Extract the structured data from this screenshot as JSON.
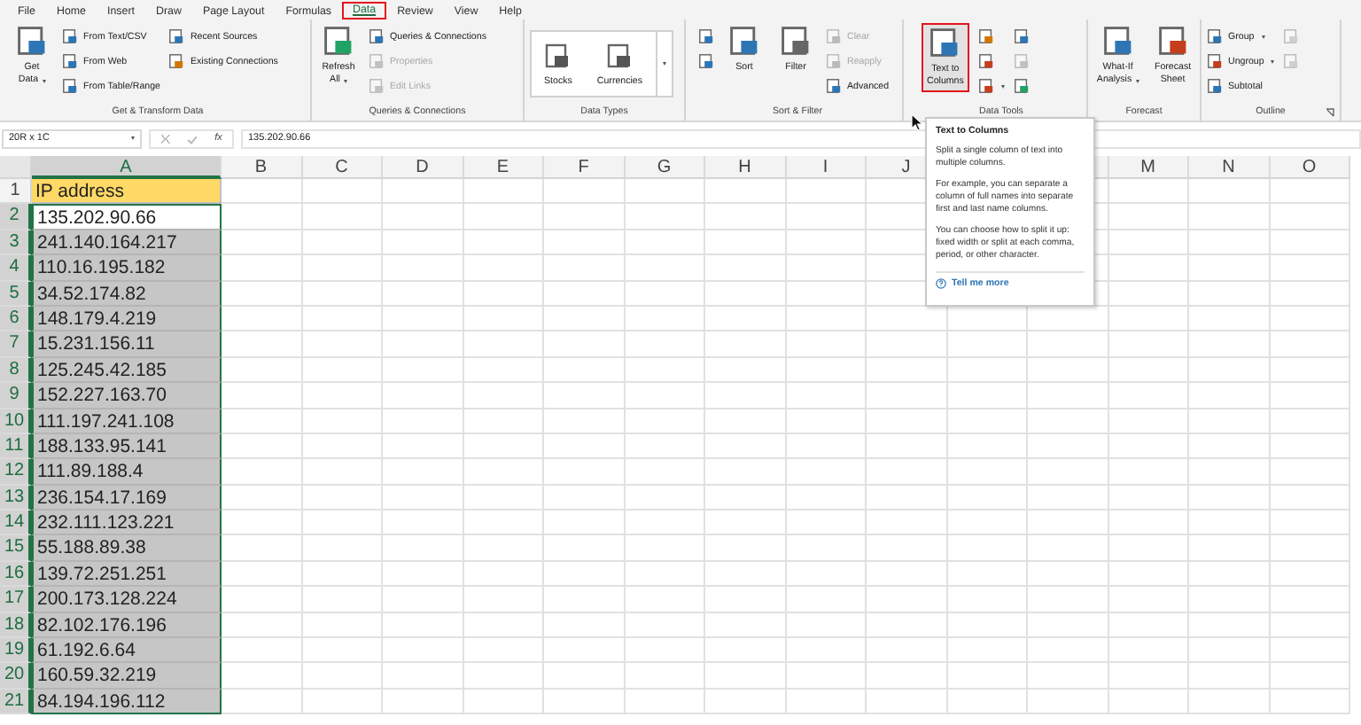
{
  "menu_tabs": [
    {
      "label": "File",
      "selected": false,
      "highlighted": false
    },
    {
      "label": "Home",
      "selected": false,
      "highlighted": false
    },
    {
      "label": "Insert",
      "selected": false,
      "highlighted": false
    },
    {
      "label": "Draw",
      "selected": false,
      "highlighted": false
    },
    {
      "label": "Page Layout",
      "selected": false,
      "highlighted": false
    },
    {
      "label": "Formulas",
      "selected": false,
      "highlighted": false
    },
    {
      "label": "Data",
      "selected": true,
      "highlighted": true
    },
    {
      "label": "Review",
      "selected": false,
      "highlighted": false
    },
    {
      "label": "View",
      "selected": false,
      "highlighted": false
    },
    {
      "label": "Help",
      "selected": false,
      "highlighted": false
    }
  ],
  "ribbon": {
    "groups": [
      {
        "label": "Get & Transform Data",
        "launcher": false,
        "parts": [
          {
            "kind": "large",
            "lines": [
              "Get",
              "Data"
            ],
            "dropdown": true
          },
          {
            "kind": "stack",
            "items": [
              {
                "label": "From Text/CSV",
                "disabled": false
              },
              {
                "label": "From Web",
                "disabled": false
              },
              {
                "label": "From Table/Range",
                "disabled": false
              }
            ]
          },
          {
            "kind": "stack",
            "items": [
              {
                "label": "Recent Sources",
                "disabled": false
              },
              {
                "label": "Existing Connections",
                "disabled": false
              }
            ]
          }
        ]
      },
      {
        "label": "Queries & Connections",
        "launcher": false,
        "parts": [
          {
            "kind": "large",
            "lines": [
              "Refresh",
              "All"
            ],
            "dropdown": true
          },
          {
            "kind": "stack",
            "items": [
              {
                "label": "Queries & Connections",
                "disabled": false
              },
              {
                "label": "Properties",
                "disabled": true
              },
              {
                "label": "Edit Links",
                "disabled": true
              }
            ]
          }
        ]
      },
      {
        "label": "Data Types",
        "launcher": false,
        "parts": [
          {
            "kind": "gallery",
            "items": [
              {
                "label": "Stocks"
              },
              {
                "label": "Currencies"
              }
            ]
          }
        ]
      },
      {
        "label": "Sort & Filter",
        "launcher": false,
        "parts": [
          {
            "kind": "stack",
            "items": [
              {
                "disabled": false
              },
              {
                "disabled": false
              }
            ]
          },
          {
            "kind": "large",
            "lines": [
              "Sort"
            ],
            "dropdown": false
          },
          {
            "kind": "large",
            "lines": [
              "Filter"
            ],
            "dropdown": false
          },
          {
            "kind": "stack",
            "items": [
              {
                "label": "Clear",
                "disabled": true
              },
              {
                "label": "Reapply",
                "disabled": true
              },
              {
                "label": "Advanced",
                "disabled": false
              }
            ]
          }
        ]
      },
      {
        "label": "Data Tools",
        "launcher": false,
        "parts": [
          {
            "kind": "large",
            "lines": [
              "Text to",
              "Columns"
            ],
            "dropdown": false,
            "highlighted": true
          },
          {
            "kind": "stack",
            "items": [
              {
                "disabled": false
              },
              {
                "disabled": false
              },
              {
                "disabled": false,
                "dropdown": true
              }
            ]
          },
          {
            "kind": "stack",
            "items": [
              {
                "disabled": false
              },
              {
                "disabled": true
              },
              {
                "disabled": false
              }
            ]
          }
        ]
      },
      {
        "label": "Forecast",
        "launcher": false,
        "parts": [
          {
            "kind": "large",
            "lines": [
              "What-If",
              "Analysis"
            ],
            "dropdown": true
          },
          {
            "kind": "large",
            "lines": [
              "Forecast",
              "Sheet"
            ],
            "dropdown": false
          }
        ]
      },
      {
        "label": "Outline",
        "launcher": true,
        "parts": [
          {
            "kind": "stack",
            "items": [
              {
                "label": "Group",
                "disabled": false,
                "dropdown": true
              },
              {
                "label": "Ungroup",
                "disabled": false,
                "dropdown": true
              },
              {
                "label": "Subtotal",
                "disabled": false
              }
            ]
          },
          {
            "kind": "stack",
            "items": [
              {
                "disabled": true
              },
              {
                "disabled": true
              }
            ]
          }
        ]
      }
    ]
  },
  "formula_bar": {
    "name_box": "20R x 1C",
    "function_label": "fx",
    "value": "135.202.90.66"
  },
  "sheet": {
    "columns": [
      "A",
      "B",
      "C",
      "D",
      "E",
      "F",
      "G",
      "H",
      "I",
      "J",
      null,
      null,
      "M",
      "N",
      "O"
    ],
    "rows": [
      {
        "number": "1",
        "value": "IP address",
        "kind": "header",
        "selected": false,
        "active": false
      },
      {
        "number": "2",
        "value": "135.202.90.66",
        "kind": "data",
        "selected": true,
        "active": true
      },
      {
        "number": "3",
        "value": "241.140.164.217",
        "kind": "data",
        "selected": true,
        "active": false
      },
      {
        "number": "4",
        "value": "110.16.195.182",
        "kind": "data",
        "selected": true,
        "active": false
      },
      {
        "number": "5",
        "value": "34.52.174.82",
        "kind": "data",
        "selected": true,
        "active": false
      },
      {
        "number": "6",
        "value": "148.179.4.219",
        "kind": "data",
        "selected": true,
        "active": false
      },
      {
        "number": "7",
        "value": "15.231.156.11",
        "kind": "data",
        "selected": true,
        "active": false
      },
      {
        "number": "8",
        "value": "125.245.42.185",
        "kind": "data",
        "selected": true,
        "active": false
      },
      {
        "number": "9",
        "value": "152.227.163.70",
        "kind": "data",
        "selected": true,
        "active": false
      },
      {
        "number": "10",
        "value": "111.197.241.108",
        "kind": "data",
        "selected": true,
        "active": false
      },
      {
        "number": "11",
        "value": "188.133.95.141",
        "kind": "data",
        "selected": true,
        "active": false
      },
      {
        "number": "12",
        "value": "111.89.188.4",
        "kind": "data",
        "selected": true,
        "active": false
      },
      {
        "number": "13",
        "value": "236.154.17.169",
        "kind": "data",
        "selected": true,
        "active": false
      },
      {
        "number": "14",
        "value": "232.111.123.221",
        "kind": "data",
        "selected": true,
        "active": false
      },
      {
        "number": "15",
        "value": "55.188.89.38",
        "kind": "data",
        "selected": true,
        "active": false
      },
      {
        "number": "16",
        "value": "139.72.251.251",
        "kind": "data",
        "selected": true,
        "active": false
      },
      {
        "number": "17",
        "value": "200.173.128.224",
        "kind": "data",
        "selected": true,
        "active": false
      },
      {
        "number": "18",
        "value": "82.102.176.196",
        "kind": "data",
        "selected": true,
        "active": false
      },
      {
        "number": "19",
        "value": "61.192.6.64",
        "kind": "data",
        "selected": true,
        "active": false
      },
      {
        "number": "20",
        "value": "160.59.32.219",
        "kind": "data",
        "selected": true,
        "active": false
      },
      {
        "number": "21",
        "value": "84.194.196.112",
        "kind": "data",
        "selected": true,
        "active": false
      }
    ]
  },
  "tooltip": {
    "title": "Text to Columns",
    "paragraphs": [
      "Split a single column of text into multiple columns.",
      "For example, you can separate a column of full names into separate first and last name columns.",
      "You can choose how to split it up: fixed width or split at each comma, period, or other character."
    ],
    "link": "Tell me more"
  }
}
